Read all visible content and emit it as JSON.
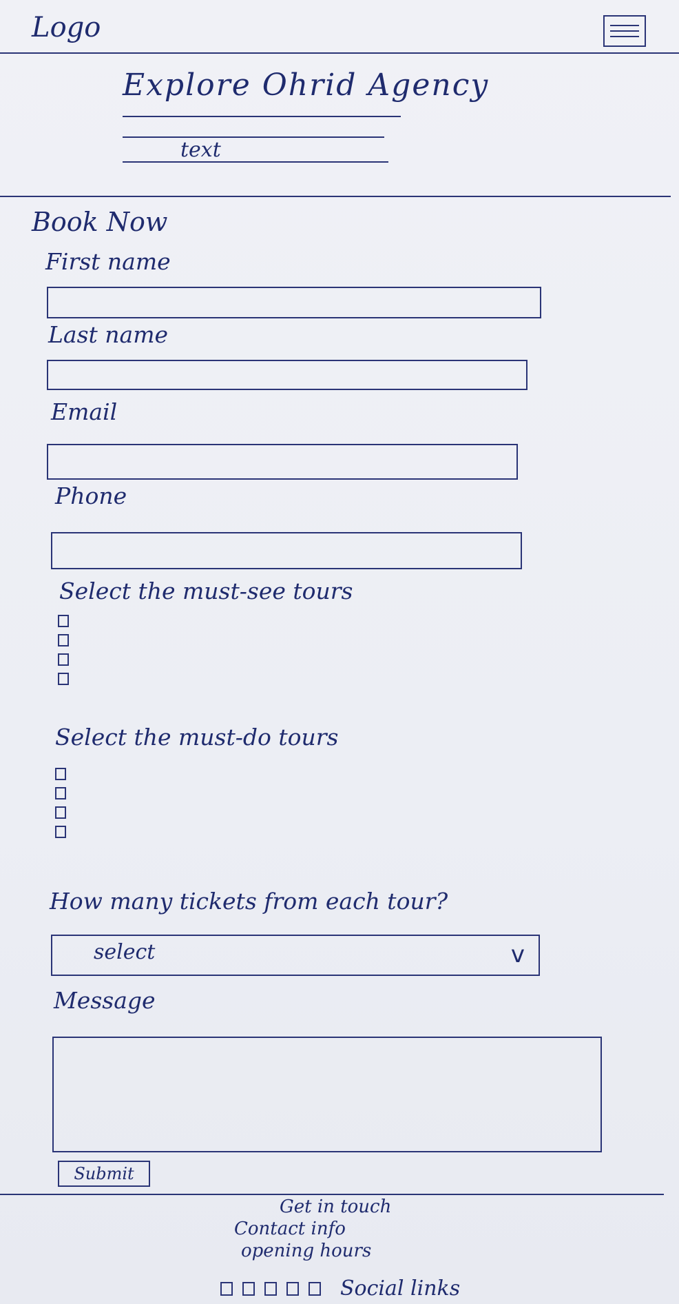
{
  "header": {
    "logo": "Logo"
  },
  "hero": {
    "title": "Explore Ohrid Agency",
    "text": "text"
  },
  "form": {
    "title": "Book Now",
    "first_name_label": "First name",
    "last_name_label": "Last name",
    "email_label": "Email",
    "phone_label": "Phone",
    "must_see_label": "Select the must-see tours",
    "must_do_label": "Select the must-do tours",
    "tickets_label": "How many tickets from each tour?",
    "tickets_select_value": "select",
    "tickets_select_chevron": "v",
    "message_label": "Message",
    "submit_label": "Submit"
  },
  "footer": {
    "get_in_touch": "Get in touch",
    "contact_info": "Contact info",
    "opening_hours": "opening hours",
    "social_links": "Social links"
  }
}
